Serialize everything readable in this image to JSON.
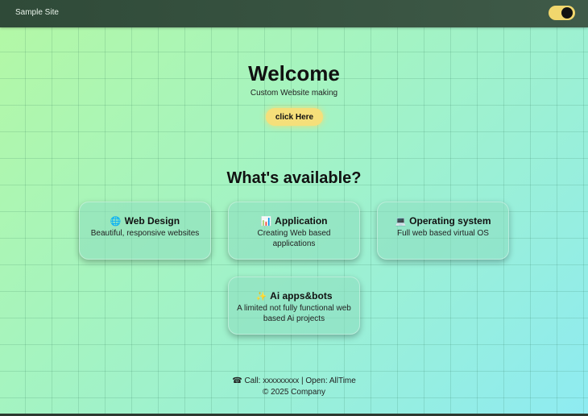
{
  "header": {
    "site_title": "Sample Site",
    "theme_toggle_state": "on"
  },
  "hero": {
    "title": "Welcome",
    "subtitle": "Custom Website making",
    "button_label": "click Here"
  },
  "section": {
    "title": "What's available?"
  },
  "cards": [
    {
      "icon": "🌐",
      "icon_name": "globe-icon",
      "title": "Web Design",
      "description": "Beautiful, responsive websites"
    },
    {
      "icon": "📊",
      "icon_name": "bar-chart-icon",
      "title": "Application",
      "description": "Creating Web based applications"
    },
    {
      "icon": "💻",
      "icon_name": "computer-icon",
      "title": "Operating system",
      "description": "Full web based virtual OS"
    },
    {
      "icon": "✨",
      "icon_name": "sparkles-icon",
      "title": "Ai apps&bots",
      "description": "A limited not fully functional web based Ai projects"
    }
  ],
  "footer": {
    "phone_icon": "☎",
    "contact": "Call: xxxxxxxxx | Open: AllTime",
    "copyright": "© 2025 Company"
  },
  "colors": {
    "header_bg": "#3a5443",
    "toggle_bg": "#f1d76d",
    "cta_bg": "#f5df7a"
  }
}
